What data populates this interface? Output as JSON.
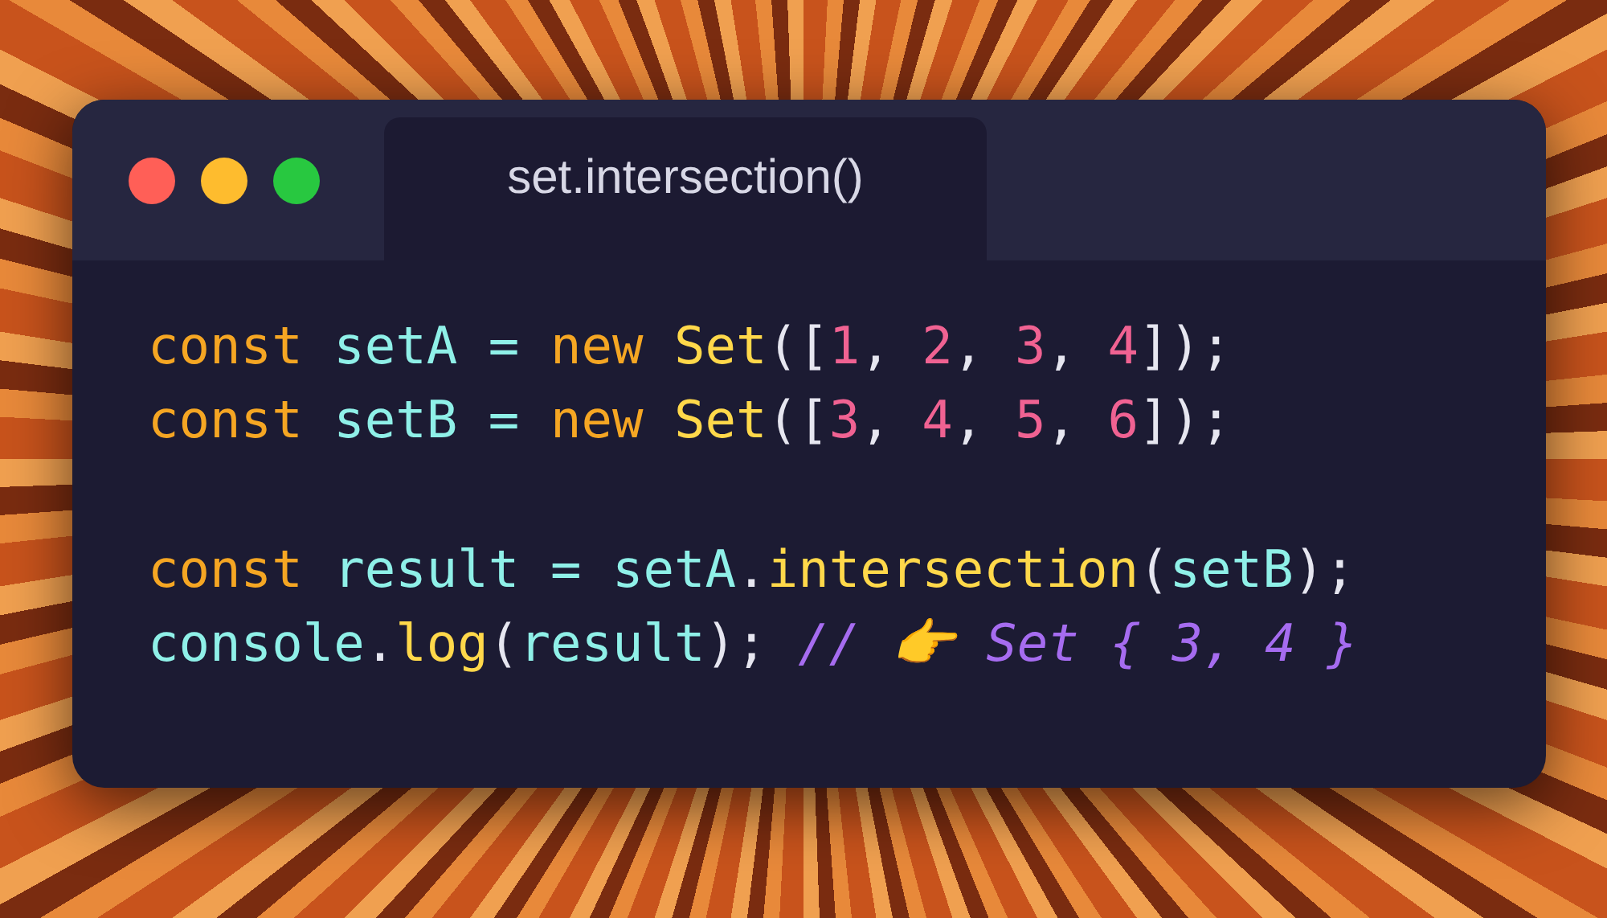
{
  "window": {
    "tab": {
      "label": "set.intersection()",
      "selected": true
    }
  },
  "code_blocks": [
    [
      [
        {
          "kind": "keyword",
          "text": "const "
        },
        {
          "kind": "variable",
          "text": "setA = "
        },
        {
          "kind": "keyword",
          "text": "new "
        },
        {
          "kind": "function",
          "text": "Set"
        },
        {
          "kind": "punct",
          "text": "(["
        },
        {
          "kind": "number",
          "text": "1"
        },
        {
          "kind": "punct",
          "text": ", "
        },
        {
          "kind": "number",
          "text": "2"
        },
        {
          "kind": "punct",
          "text": ", "
        },
        {
          "kind": "number",
          "text": "3"
        },
        {
          "kind": "punct",
          "text": ", "
        },
        {
          "kind": "number",
          "text": "4"
        },
        {
          "kind": "punct",
          "text": "]);"
        }
      ],
      [
        {
          "kind": "keyword",
          "text": "const "
        },
        {
          "kind": "variable",
          "text": "setB = "
        },
        {
          "kind": "keyword",
          "text": "new "
        },
        {
          "kind": "function",
          "text": "Set"
        },
        {
          "kind": "punct",
          "text": "(["
        },
        {
          "kind": "number",
          "text": "3"
        },
        {
          "kind": "punct",
          "text": ", "
        },
        {
          "kind": "number",
          "text": "4"
        },
        {
          "kind": "punct",
          "text": ", "
        },
        {
          "kind": "number",
          "text": "5"
        },
        {
          "kind": "punct",
          "text": ", "
        },
        {
          "kind": "number",
          "text": "6"
        },
        {
          "kind": "punct",
          "text": "]);"
        }
      ]
    ],
    [
      [
        {
          "kind": "keyword",
          "text": "const "
        },
        {
          "kind": "variable",
          "text": "result = setA"
        },
        {
          "kind": "punct",
          "text": "."
        },
        {
          "kind": "function",
          "text": "intersection"
        },
        {
          "kind": "punct",
          "text": "("
        },
        {
          "kind": "variable",
          "text": "setB"
        },
        {
          "kind": "punct",
          "text": ");"
        }
      ],
      [
        {
          "kind": "variable",
          "text": "console"
        },
        {
          "kind": "punct",
          "text": "."
        },
        {
          "kind": "function",
          "text": "log"
        },
        {
          "kind": "punct",
          "text": "("
        },
        {
          "kind": "variable",
          "text": "result"
        },
        {
          "kind": "punct",
          "text": "); "
        },
        {
          "kind": "comment",
          "text": "// 👉 Set { 3, 4 }"
        }
      ]
    ]
  ]
}
